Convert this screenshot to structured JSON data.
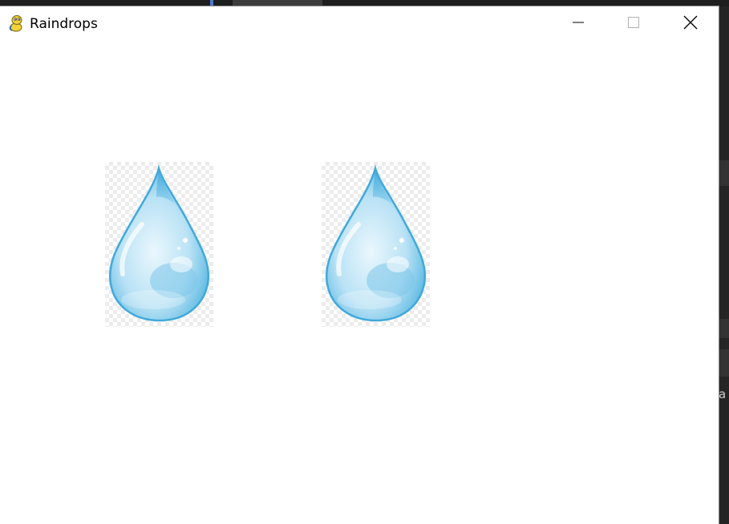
{
  "window": {
    "title": "Raindrops",
    "app_icon": "python-snake-icon",
    "controls": {
      "minimize": "minimize-icon",
      "maximize": "maximize-icon",
      "close": "close-icon"
    }
  },
  "canvas": {
    "sprites": [
      {
        "name": "raindrop",
        "icon": "raindrop-icon"
      },
      {
        "name": "raindrop",
        "icon": "raindrop-icon"
      }
    ]
  },
  "background_fragment": {
    "text": "a"
  },
  "colors": {
    "window_bg": "#ffffff",
    "drop_light": "#c9e9f7",
    "drop_mid": "#8fd0ee",
    "drop_dark": "#3fa9dc"
  }
}
